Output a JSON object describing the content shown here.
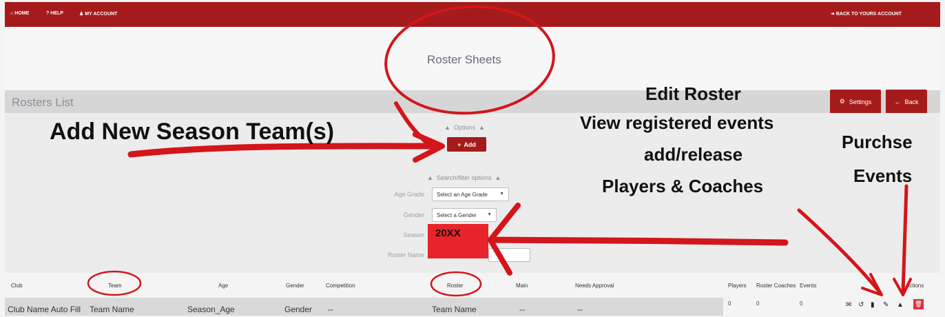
{
  "nav": {
    "home": "HOME",
    "help": "HELP",
    "account": "MY ACCOUNT",
    "back_account": "BACK TO YOURS ACCOUNT"
  },
  "page_title": "Roster Sheets",
  "list_title": "Rosters List",
  "buttons": {
    "settings": "Settings",
    "back": "Back",
    "add": "Add"
  },
  "options_label": "Options",
  "search_label": "Search/filter options",
  "filters": {
    "age_grade_label": "Age Grade",
    "age_grade_value": "Select an Age Grade",
    "gender_label": "Gender",
    "gender_value": "Select a Gender",
    "season_label": "Season",
    "season_value": "20XX",
    "roster_name_label": "Roster Name"
  },
  "table": {
    "headers": [
      "Club",
      "Team",
      "Age",
      "Gender",
      "Competition",
      "Roster",
      "Main",
      "Needs Approval",
      "Players",
      "Roster Coaches",
      "Events",
      "Actions"
    ],
    "row": {
      "club": "Club Name Auto Fill",
      "team": "Team Name",
      "age": "Season_Age",
      "gender": "Gender",
      "competition": "--",
      "roster": "Team Name",
      "main": "--",
      "needs_approval": "--",
      "players": "0",
      "roster_coaches": "0",
      "events": "0"
    }
  },
  "annotations": {
    "add_team": "Add New Season Team(s)",
    "edit_line1": "Edit Roster",
    "edit_line2": "View registered events",
    "edit_line3": "add/release",
    "edit_line4": "Players & Coaches",
    "purchase_line1": "Purchse",
    "purchase_line2": "Events"
  },
  "colors": {
    "brand": "#a51b1b",
    "highlight": "#e8242a",
    "annotation_ink": "#d3161b"
  }
}
